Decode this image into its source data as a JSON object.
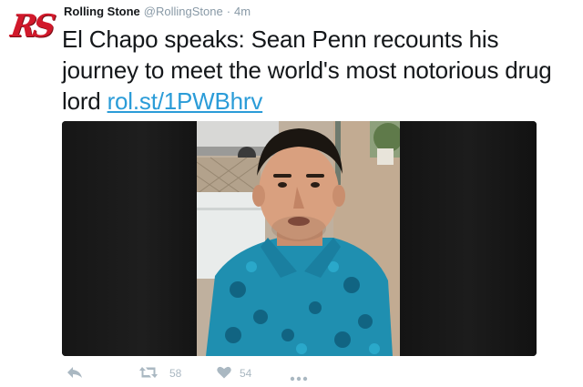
{
  "account": {
    "display_name": "Rolling Stone",
    "handle": "@RollingStone",
    "separator": "·",
    "time": "4m",
    "avatar_text": "RS",
    "brand_color": "#d1192b"
  },
  "tweet": {
    "text": "El Chapo speaks: Sean Penn recounts his journey to meet the world's most notorious drug lord",
    "link_text": "rol.st/1PWBhrv",
    "link_color": "#2b9cd8"
  },
  "media": {
    "type": "video",
    "description_icon": "video-thumbnail"
  },
  "actions": {
    "reply_icon": "reply-icon",
    "retweet_icon": "retweet-icon",
    "retweet_count": "58",
    "like_icon": "heart-icon",
    "like_count": "54",
    "more_icon": "more-icon",
    "icon_color": "#aab8c2"
  }
}
